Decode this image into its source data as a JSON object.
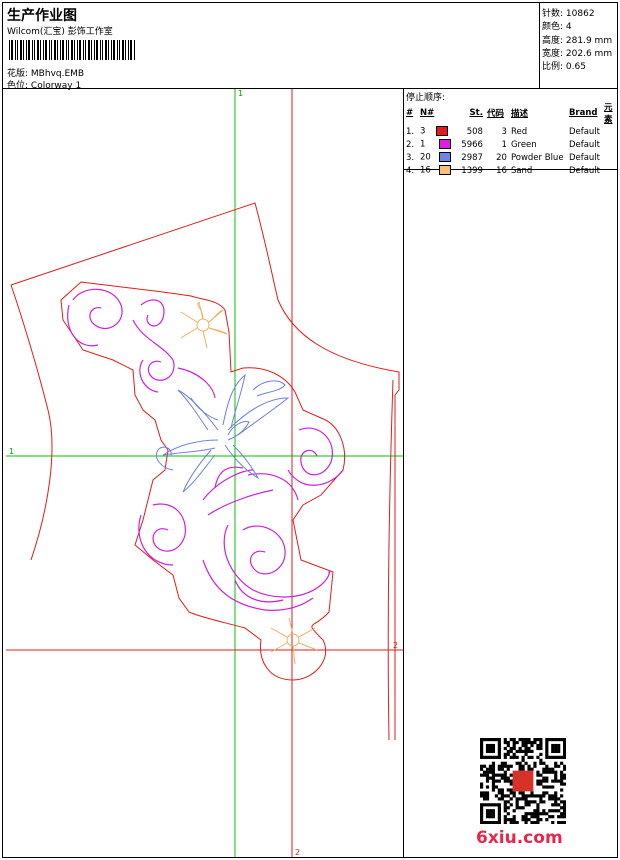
{
  "header": {
    "title": "生产作业图",
    "company": "Wilcom(汇宝) 彭饰工作室",
    "design_label": "花版:",
    "design_value": "MBhvq.EMB",
    "colorway_label": "色位:",
    "colorway_value": "Colorway 1"
  },
  "stats": [
    {
      "label": "针数:",
      "value": "10862"
    },
    {
      "label": "颜色:",
      "value": "4"
    },
    {
      "label": "高度:",
      "value": "281.9 mm"
    },
    {
      "label": "宽度:",
      "value": "202.6 mm"
    },
    {
      "label": "比例:",
      "value": "0.65"
    }
  ],
  "sequence": {
    "title": "停止顺序:",
    "headers": {
      "num": "#",
      "n": "N#",
      "st": "St.",
      "code": "代码",
      "desc": "描述",
      "brand": "Brand",
      "element": "元素"
    },
    "rows": [
      {
        "num": "1.",
        "n": "3",
        "color": "#e31b1b",
        "st": "508",
        "code": "3",
        "desc": "Red",
        "brand": "Default"
      },
      {
        "num": "2.",
        "n": "1",
        "color": "#e21ce3",
        "st": "5966",
        "code": "1",
        "desc": "Green",
        "brand": "Default"
      },
      {
        "num": "3.",
        "n": "20",
        "color": "#6e86e6",
        "st": "2987",
        "code": "20",
        "desc": "Powder Blue",
        "brand": "Default"
      },
      {
        "num": "4.",
        "n": "16",
        "color": "#f7c07e",
        "st": "1399",
        "code": "16",
        "desc": "Sand",
        "brand": "Default"
      }
    ]
  },
  "canvas": {
    "axis_labels": {
      "green_top": "1",
      "green_left": "1",
      "red_right": "2",
      "red_bottom": "2"
    },
    "colors": {
      "guide_green": "#00c400",
      "guide_red": "#e31b1b",
      "outline_red": "#e31b1b",
      "magenta": "#cc22dd",
      "blue": "#7080e0",
      "sand": "#f0b060"
    }
  },
  "watermark": {
    "site": "6xiu.com"
  }
}
